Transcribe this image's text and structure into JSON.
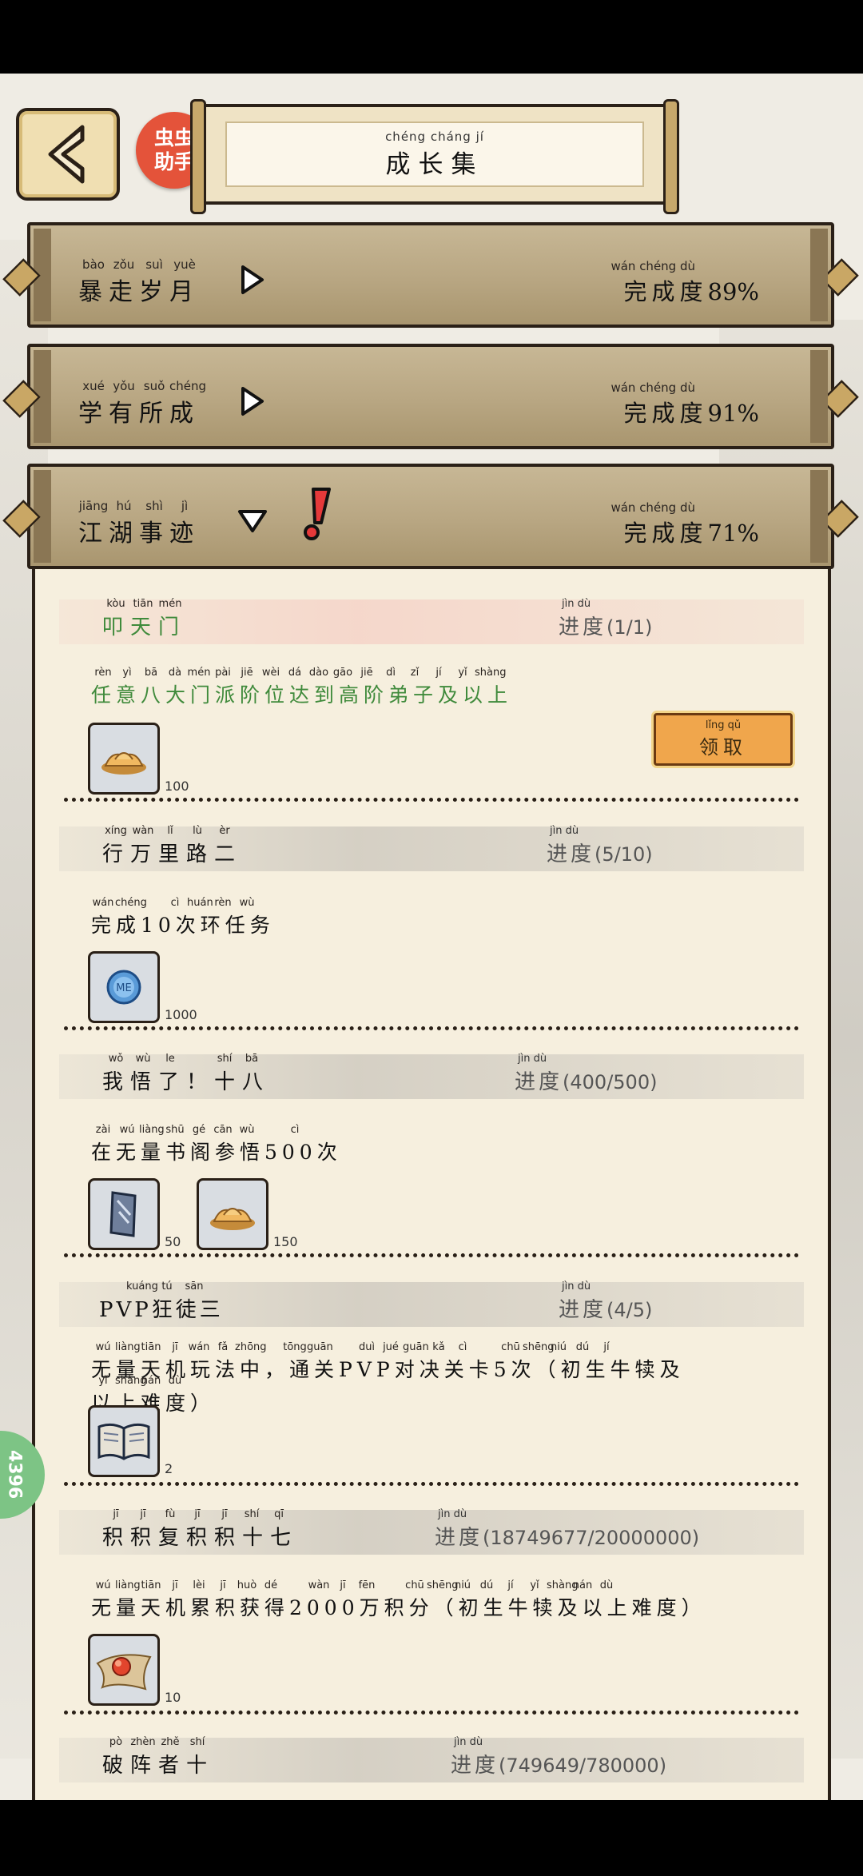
{
  "header": {
    "back_label": "back",
    "helper_line1": "虫虫",
    "helper_line2": "助手",
    "title_pinyin": [
      "chéng",
      "cháng",
      "jí"
    ],
    "title": "成长集"
  },
  "categories": [
    {
      "pinyin": [
        "bào",
        "zǒu",
        "suì",
        "yuè"
      ],
      "name": "暴走岁月",
      "state": "collapsed",
      "completion_pinyin": "wán chéng dù",
      "completion_label": "完成度",
      "completion_value": "89%"
    },
    {
      "pinyin": [
        "xué",
        "yǒu",
        "suǒ",
        "chéng"
      ],
      "name": "学有所成",
      "state": "collapsed",
      "completion_pinyin": "wán chéng dù",
      "completion_label": "完成度",
      "completion_value": "91%"
    },
    {
      "pinyin": [
        "jiāng",
        "hú",
        "shì",
        "jì"
      ],
      "name": "江湖事迹",
      "state": "expanded",
      "completion_pinyin": "wán chéng dù",
      "completion_label": "完成度",
      "completion_value": "71%"
    }
  ],
  "achievements": [
    {
      "name_pinyin": [
        "kòu",
        "tiān",
        "mén"
      ],
      "name": "叩天门",
      "progress_pinyin": "jìn dù",
      "progress_label": "进度",
      "progress_value": "(1/1)",
      "desc_pinyin": [
        "rèn",
        "yì",
        "bā",
        "dà",
        "mén",
        "pài",
        "jiē",
        "wèi",
        "dá",
        "dào",
        "gāo",
        "jiē",
        "dì",
        "zǐ",
        "jí",
        "yǐ",
        "shàng"
      ],
      "desc": "任意八大门派阶位达到高阶弟子及以上",
      "rewards": [
        {
          "icon": "gold-ingot-icon",
          "count": "100"
        }
      ],
      "claim_pinyin": "lǐng qǔ",
      "claim_label": "领取"
    },
    {
      "name_pinyin": [
        "xíng",
        "wàn",
        "lǐ",
        "lù",
        "èr"
      ],
      "name": "行万里路二",
      "progress_pinyin": "jìn dù",
      "progress_label": "进度",
      "progress_value": "(5/10)",
      "desc_pinyin": [
        "wán",
        "chéng",
        "",
        "cì",
        "huán",
        "rèn",
        "wù"
      ],
      "desc": "完成10次环任务",
      "rewards": [
        {
          "icon": "coin-icon",
          "count": "1000",
          "icon_text": "ME"
        }
      ]
    },
    {
      "name_pinyin": [
        "wǒ",
        "wù",
        "le",
        "",
        "shí",
        "bā"
      ],
      "name": "我悟了！十八",
      "progress_pinyin": "jìn dù",
      "progress_label": "进度",
      "progress_value": "(400/500)",
      "desc_pinyin": [
        "zài",
        "wú",
        "liàng",
        "shū",
        "gé",
        "cān",
        "wù",
        "",
        "cì"
      ],
      "desc": "在无量书阁参悟500次",
      "rewards": [
        {
          "icon": "scroll-icon",
          "count": "50"
        },
        {
          "icon": "gold-ingot-icon",
          "count": "150"
        }
      ]
    },
    {
      "name_pinyin": [
        "",
        "kuáng",
        "tú",
        "sān"
      ],
      "name": "PVP狂徒三",
      "progress_pinyin": "jìn dù",
      "progress_label": "进度",
      "progress_value": "(4/5)",
      "desc_pinyin": [
        "wú",
        "liàng",
        "tiān",
        "jī",
        "wán",
        "fǎ",
        "zhōng",
        "",
        "tōng",
        "guān",
        "",
        "duì",
        "jué",
        "guān",
        "kǎ",
        "cì",
        "",
        "chū",
        "shēng",
        "niú",
        "dú",
        "jí"
      ],
      "desc": "无量天机玩法中，通关PVP对决关卡5次（初生牛犊及",
      "desc_line2_pinyin": [
        "yǐ",
        "shàng",
        "nán",
        "dù"
      ],
      "desc_line2": "以上难度）",
      "rewards": [
        {
          "icon": "book-icon",
          "count": "2"
        }
      ]
    },
    {
      "name_pinyin": [
        "jī",
        "jī",
        "fù",
        "jī",
        "jī",
        "shí",
        "qī"
      ],
      "name": "积积复积积十七",
      "progress_pinyin": "jìn dù",
      "progress_label": "进度",
      "progress_value": "(18749677/20000000)",
      "desc_pinyin": [
        "wú",
        "liàng",
        "tiān",
        "jī",
        "lèi",
        "jī",
        "huò",
        "dé",
        "",
        "wàn",
        "jī",
        "fēn",
        "",
        "chū",
        "shēng",
        "niú",
        "dú",
        "jí",
        "yǐ",
        "shàng",
        "nán",
        "dù"
      ],
      "desc": "无量天机累积获得2000万积分（初生牛犊及以上难度）",
      "rewards": [
        {
          "icon": "red-orb-icon",
          "count": "10"
        }
      ]
    },
    {
      "name_pinyin": [
        "pò",
        "zhèn",
        "zhě",
        "shí"
      ],
      "name": "破阵者十",
      "progress_pinyin": "jìn dù",
      "progress_label": "进度",
      "progress_value": "(749649/780000)",
      "rewards": []
    }
  ],
  "side_badge": "4396",
  "colors": {
    "accent_green": "#3f8a3b",
    "claim_orange": "#f0a64c",
    "frame": "#2a2017",
    "panel": "#f6efde"
  }
}
